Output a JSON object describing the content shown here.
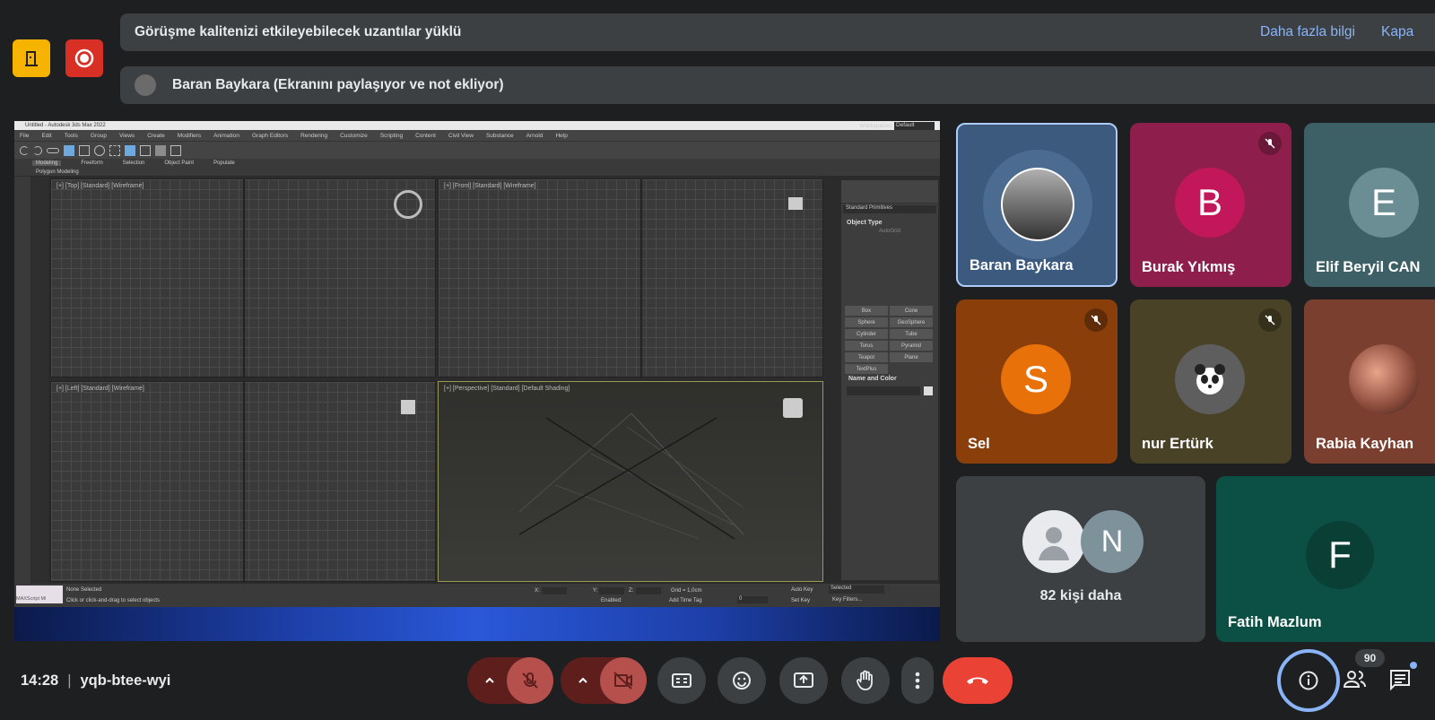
{
  "record_buttons": {
    "door_icon": "door-icon",
    "record_icon": "record-icon"
  },
  "banners": {
    "extension_warning": "Görüşme kalitenizi etkileyebilecek uzantılar yüklü",
    "learn_more": "Daha fazla bilgi",
    "close": "Kapa",
    "presenter": "Baran Baykara (Ekranını paylaşıyor ve not ekliyor)"
  },
  "shared_screen": {
    "title": "Untitled - Autodesk 3ds Max 2022",
    "menu": [
      "File",
      "Edit",
      "Tools",
      "Group",
      "Views",
      "Create",
      "Modifiers",
      "Animation",
      "Graph Editors",
      "Rendering",
      "Customize",
      "Scripting",
      "Content",
      "Civil View",
      "Substance",
      "Arnold",
      "Help"
    ],
    "workspace_label": "Workspaces:",
    "workspace_value": "Default",
    "ribbon_tabs": [
      "Modeling",
      "Freeform",
      "Selection",
      "Object Paint",
      "Populate"
    ],
    "ribbon_sub": "Polygon Modeling",
    "viewports": {
      "top": "[+] [Top] [Standard] [Wireframe]",
      "front": "[+] [Front] [Standard] [Wireframe]",
      "left": "[+] [Left] [Standard] [Wireframe]",
      "perspective": "[+] [Perspective] [Standard] [Default Shading]"
    },
    "panel": {
      "dropdown": "Standard Primitives",
      "object_type": "Object Type",
      "autogrid": "AutoGrid",
      "buttons": [
        "Box",
        "Cone",
        "Sphere",
        "GeoSphere",
        "Cylinder",
        "Tube",
        "Torus",
        "Pyramid",
        "Teapot",
        "Plane",
        "TextPlus"
      ],
      "name_color": "Name and Color"
    },
    "status": {
      "maxscript": "MAXScript Mi",
      "selected": "None Selected",
      "hint": "Click or click-and-drag to select objects",
      "grid": "Grid = 1,0cm",
      "add_time_tag": "Add Time Tag",
      "enabled": "Enabled:",
      "auto_key": "Auto Key",
      "set_key": "Set Key",
      "selected_dd": "Selected",
      "key_filters": "Key Filters...",
      "x": "X:",
      "y": "Y:",
      "z": "Z:",
      "frame": "0"
    }
  },
  "participants": [
    {
      "name": "Baran Baykara",
      "avatar": "photo-avatar",
      "muted": false,
      "bg": "#3b5a7e"
    },
    {
      "name": "Burak Yıkmış",
      "initial": "B",
      "muted": true,
      "bg": "#8e1f4d",
      "avatar_color": "#c2185b"
    },
    {
      "name": "Elif Beryil CAN",
      "initial": "E",
      "muted": false,
      "bg": "#3d6066",
      "avatar_color": "#6b8e95"
    },
    {
      "name": "Sel",
      "initial": "S",
      "muted": true,
      "bg": "#8a3f0a",
      "avatar_color": "#e8710a"
    },
    {
      "name": "nur Ertürk",
      "avatar": "panda-avatar",
      "muted": true,
      "bg": "#4a4226"
    },
    {
      "name": "Rabia Kayhan",
      "avatar": "planet-avatar",
      "muted": false,
      "bg": "#7a3f2e"
    }
  ],
  "others": {
    "label": "82 kişi daha",
    "initial": "N"
  },
  "fatih": {
    "name": "Fatih Mazlum",
    "initial": "F"
  },
  "bottom": {
    "time": "14:28",
    "separator": "|",
    "meeting_code": "yqb-btee-wyi",
    "people_count": "90"
  },
  "colors": {
    "end_call": "#ea4335",
    "highlight": "#8ab4f8",
    "mic_off": "#b5504d"
  }
}
